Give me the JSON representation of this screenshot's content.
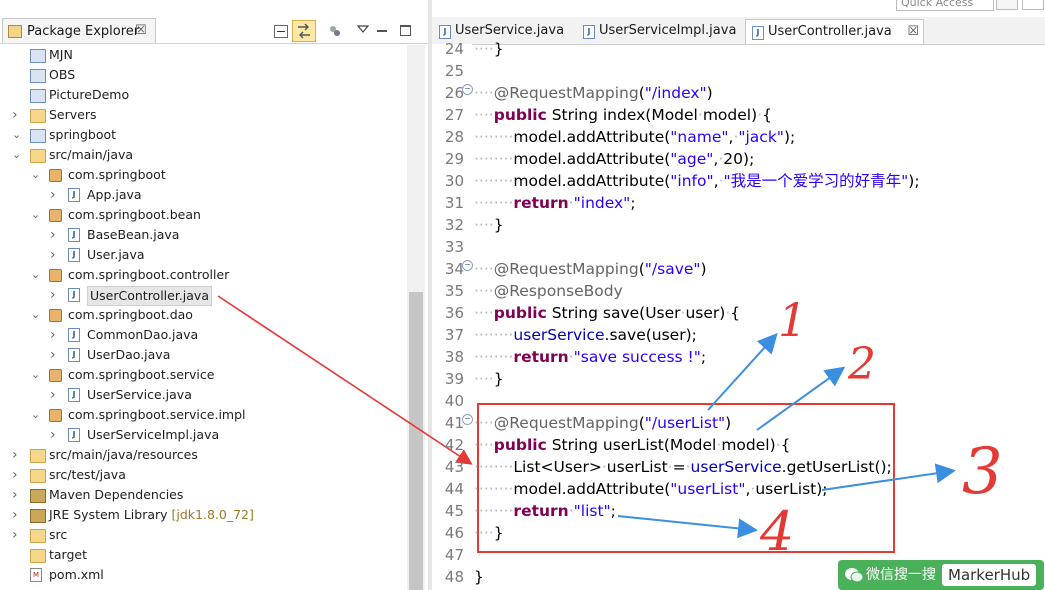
{
  "toolbar": {
    "quick_access_placeholder": "Quick Access"
  },
  "package_explorer": {
    "title": "Package Explorer",
    "close_glyph": "☒",
    "tree": [
      {
        "label": "MJN",
        "type": "proj",
        "depth": 1,
        "arrow": ""
      },
      {
        "label": "OBS",
        "type": "proj",
        "depth": 1,
        "arrow": ""
      },
      {
        "label": "PictureDemo",
        "type": "proj",
        "depth": 1,
        "arrow": ""
      },
      {
        "label": "Servers",
        "type": "folder",
        "depth": 0,
        "arrow": ">"
      },
      {
        "label": "springboot",
        "type": "proj",
        "depth": 0,
        "arrow": "v"
      },
      {
        "label": "src/main/java",
        "type": "folder",
        "depth": 1,
        "arrow": "v"
      },
      {
        "label": "com.springboot",
        "type": "pkg",
        "depth": 2,
        "arrow": "v"
      },
      {
        "label": "App.java",
        "type": "java",
        "depth": 3,
        "arrow": ">"
      },
      {
        "label": "com.springboot.bean",
        "type": "pkg",
        "depth": 2,
        "arrow": "v"
      },
      {
        "label": "BaseBean.java",
        "type": "java",
        "depth": 3,
        "arrow": ">"
      },
      {
        "label": "User.java",
        "type": "java",
        "depth": 3,
        "arrow": ">"
      },
      {
        "label": "com.springboot.controller",
        "type": "pkg",
        "depth": 2,
        "arrow": "v"
      },
      {
        "label": "UserController.java",
        "type": "java",
        "depth": 3,
        "arrow": ">",
        "selected": true
      },
      {
        "label": "com.springboot.dao",
        "type": "pkg",
        "depth": 2,
        "arrow": "v"
      },
      {
        "label": "CommonDao.java",
        "type": "java",
        "depth": 3,
        "arrow": ">"
      },
      {
        "label": "UserDao.java",
        "type": "java",
        "depth": 3,
        "arrow": ">"
      },
      {
        "label": "com.springboot.service",
        "type": "pkg",
        "depth": 2,
        "arrow": "v"
      },
      {
        "label": "UserService.java",
        "type": "java",
        "depth": 3,
        "arrow": ">"
      },
      {
        "label": "com.springboot.service.impl",
        "type": "pkg",
        "depth": 2,
        "arrow": "v"
      },
      {
        "label": "UserServiceImpl.java",
        "type": "java",
        "depth": 3,
        "arrow": ">"
      },
      {
        "label": "src/main/java/resources",
        "type": "folder",
        "depth": 1,
        "arrow": ">"
      },
      {
        "label": "src/test/java",
        "type": "folder",
        "depth": 1,
        "arrow": ">"
      },
      {
        "label": "Maven Dependencies",
        "type": "lib",
        "depth": 1,
        "arrow": ">"
      },
      {
        "label": "JRE System Library",
        "suffix": "[jdk1.8.0_72]",
        "type": "lib",
        "depth": 1,
        "arrow": ">"
      },
      {
        "label": "src",
        "type": "folder",
        "depth": 1,
        "arrow": ">"
      },
      {
        "label": "target",
        "type": "folder",
        "depth": 1,
        "arrow": ""
      },
      {
        "label": "pom.xml",
        "type": "xml",
        "depth": 1,
        "arrow": ""
      }
    ]
  },
  "editor": {
    "tabs": [
      {
        "label": "UserService.java"
      },
      {
        "label": "UserServiceImpl.java"
      },
      {
        "label": "UserController.java",
        "active": true,
        "close": "☒"
      }
    ],
    "line_numbers": [
      "24",
      "25",
      "26",
      "27",
      "28",
      "29",
      "30",
      "31",
      "32",
      "33",
      "34",
      "35",
      "36",
      "37",
      "38",
      "39",
      "40",
      "41",
      "42",
      "43",
      "44",
      "45",
      "46",
      "47",
      "48"
    ],
    "lines": [
      [
        [
          "ws",
          "····"
        ],
        [
          "",
          "}"
        ]
      ],
      [],
      [
        [
          "ws",
          "····"
        ],
        [
          "an",
          "@RequestMapping"
        ],
        [
          "",
          "("
        ],
        [
          "str",
          "\"/index\""
        ],
        [
          "",
          ")"
        ]
      ],
      [
        [
          "ws",
          "····"
        ],
        [
          "kw",
          "public"
        ],
        [
          "",
          " String index(Model"
        ],
        [
          "ws",
          "·"
        ],
        [
          "",
          "model)"
        ],
        [
          "ws",
          "·"
        ],
        [
          "",
          "{"
        ]
      ],
      [
        [
          "ws",
          "········"
        ],
        [
          "",
          "model.addAttribute("
        ],
        [
          "str",
          "\"name\""
        ],
        [
          "",
          ","
        ],
        [
          "ws",
          "·"
        ],
        [
          "str",
          "\"jack\""
        ],
        [
          "",
          ");"
        ]
      ],
      [
        [
          "ws",
          "········"
        ],
        [
          "",
          "model.addAttribute("
        ],
        [
          "str",
          "\"age\""
        ],
        [
          "",
          ","
        ],
        [
          "ws",
          "·"
        ],
        [
          "",
          "20);"
        ]
      ],
      [
        [
          "ws",
          "········"
        ],
        [
          "",
          "model.addAttribute("
        ],
        [
          "str",
          "\"info\""
        ],
        [
          "",
          ","
        ],
        [
          "ws",
          "·"
        ],
        [
          "str",
          "\"我是一个爱学习的好青年\""
        ],
        [
          "",
          ");"
        ]
      ],
      [
        [
          "ws",
          "········"
        ],
        [
          "kw",
          "return"
        ],
        [
          "ws",
          "·"
        ],
        [
          "str",
          "\"index\""
        ],
        [
          "",
          ";"
        ]
      ],
      [
        [
          "ws",
          "····"
        ],
        [
          "",
          "}"
        ]
      ],
      [],
      [
        [
          "ws",
          "····"
        ],
        [
          "an",
          "@RequestMapping"
        ],
        [
          "",
          "("
        ],
        [
          "str",
          "\"/save\""
        ],
        [
          "",
          ")"
        ]
      ],
      [
        [
          "ws",
          "····"
        ],
        [
          "an",
          "@ResponseBody"
        ]
      ],
      [
        [
          "ws",
          "····"
        ],
        [
          "kw",
          "public"
        ],
        [
          "",
          " String save(User"
        ],
        [
          "ws",
          "·"
        ],
        [
          "",
          "user)"
        ],
        [
          "ws",
          "·"
        ],
        [
          "",
          "{"
        ]
      ],
      [
        [
          "ws",
          "········"
        ],
        [
          "fld",
          "userService"
        ],
        [
          "",
          ".save(user);"
        ]
      ],
      [
        [
          "ws",
          "········"
        ],
        [
          "kw",
          "return"
        ],
        [
          "ws",
          "·"
        ],
        [
          "str",
          "\"save success !\""
        ],
        [
          "",
          ";"
        ]
      ],
      [
        [
          "ws",
          "····"
        ],
        [
          "",
          "}"
        ]
      ],
      [],
      [
        [
          "ws",
          "····"
        ],
        [
          "an",
          "@RequestMapping"
        ],
        [
          "",
          "("
        ],
        [
          "str",
          "\"/userList\""
        ],
        [
          "",
          ")"
        ]
      ],
      [
        [
          "ws",
          "····"
        ],
        [
          "kw",
          "public"
        ],
        [
          "",
          " String userList(Model"
        ],
        [
          "ws",
          "·"
        ],
        [
          "",
          "model)"
        ],
        [
          "ws",
          "·"
        ],
        [
          "",
          "{"
        ]
      ],
      [
        [
          "ws",
          "········"
        ],
        [
          "",
          "List<User>"
        ],
        [
          "ws",
          "·"
        ],
        [
          "",
          "userList"
        ],
        [
          "ws",
          "·"
        ],
        [
          "",
          "="
        ],
        [
          "ws",
          "·"
        ],
        [
          "fld",
          "userService"
        ],
        [
          "",
          ".getUserList();"
        ]
      ],
      [
        [
          "ws",
          "········"
        ],
        [
          "",
          "model.addAttribute("
        ],
        [
          "str",
          "\"userList\""
        ],
        [
          "",
          ","
        ],
        [
          "ws",
          "·"
        ],
        [
          "",
          "userList);"
        ]
      ],
      [
        [
          "ws",
          "········"
        ],
        [
          "kw",
          "return"
        ],
        [
          "ws",
          "·"
        ],
        [
          "str",
          "\"list\""
        ],
        [
          "",
          ";"
        ]
      ],
      [
        [
          "ws",
          "····"
        ],
        [
          "",
          "}"
        ]
      ],
      [],
      [
        [
          "",
          "}"
        ]
      ]
    ]
  },
  "annotations": {
    "numbers": [
      "1",
      "2",
      "3",
      "4"
    ],
    "highlight_color": "#e53935",
    "arrow_color": "#3b8fe0"
  },
  "watermark": {
    "text": "微信搜一搜",
    "brand": "MarkerHub"
  }
}
